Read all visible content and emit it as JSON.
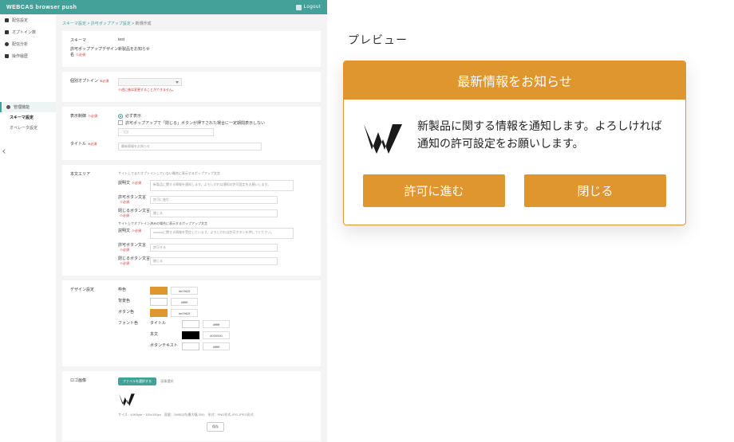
{
  "header": {
    "title": "WEBCAS browser push",
    "logout": "Logout"
  },
  "sidebar": {
    "items": [
      "配信設定",
      "オプトイン数",
      "配信分析",
      "操作履歴"
    ],
    "group_head": "管理機能",
    "subs": [
      "スキーマ設定",
      "オペレータ設定"
    ]
  },
  "breadcrumb": {
    "a": "スキーマ設定",
    "b": "許可ポップアップ設定",
    "c": "新規作成"
  },
  "form": {
    "schema_label": "スキーマ",
    "schema_value": "test",
    "design_name_label": "許可ポップアップデザイン名",
    "design_name_value": "新製品をお知らせ",
    "optin_label": "個別オプトイン",
    "optin_warn": "※途に後は変更することができません。",
    "display_label": "表示制御",
    "display_always": "必ず表示",
    "display_hide": "許可ポップアップで「閉じる」ボタンが押下された場合に一定期間表示しない",
    "display_days": "（日）",
    "title_label": "タイトル",
    "title_value": "最新情報をお知らせ",
    "body_label": "本文エリア",
    "body_note1": "サイト上でまだオプトインしていない場合に表示するポップアップ文言",
    "desc_label": "説明文",
    "desc_value": "新製品に関する情報を通知します。よろしければ通知の許可設定をお願いします。",
    "allow_btn_label": "許可ボタン文言",
    "allow_btn_value": "許可に進む",
    "close_btn_label": "閉じるボタン文言",
    "close_btn_value": "閉じる",
    "body_note2": "サイト上でオプトイン済みの場合に表示するポップアップ文言",
    "desc2_value": "xxxxxxに関する情報を受信しています。よろしければ許可ボタンを押してください。",
    "allow2_value": "許可する",
    "close2_value": "閉じる",
    "design_section": "デザイン設定",
    "row_bar": "枠色",
    "row_bg": "背景色",
    "row_btn": "ボタン色",
    "row_font": "フォント色",
    "font_title": "タイトル",
    "font_body": "本文",
    "font_btn": "ボタンテキスト",
    "hex_orange": "#e0962f",
    "hex_white": "#ffffff",
    "hex_black": "#000000",
    "logo_section": "ロゴ画像",
    "file_btn": "ファイルを選択する",
    "file_status": "画像選択",
    "logo_info": "サイズ : 44KByte・150x150px　容量：1MB以内(最大幅 200)　形式：PNG形式,JPG,JPEG形式",
    "save_btn": "保存"
  },
  "preview": {
    "label": "プレビュー",
    "title": "最新情報をお知らせ",
    "body": "新製品に関する情報を通知します。よろしければ通知の許可設定をお願いします。",
    "allow": "許可に進む",
    "close": "閉じる"
  }
}
